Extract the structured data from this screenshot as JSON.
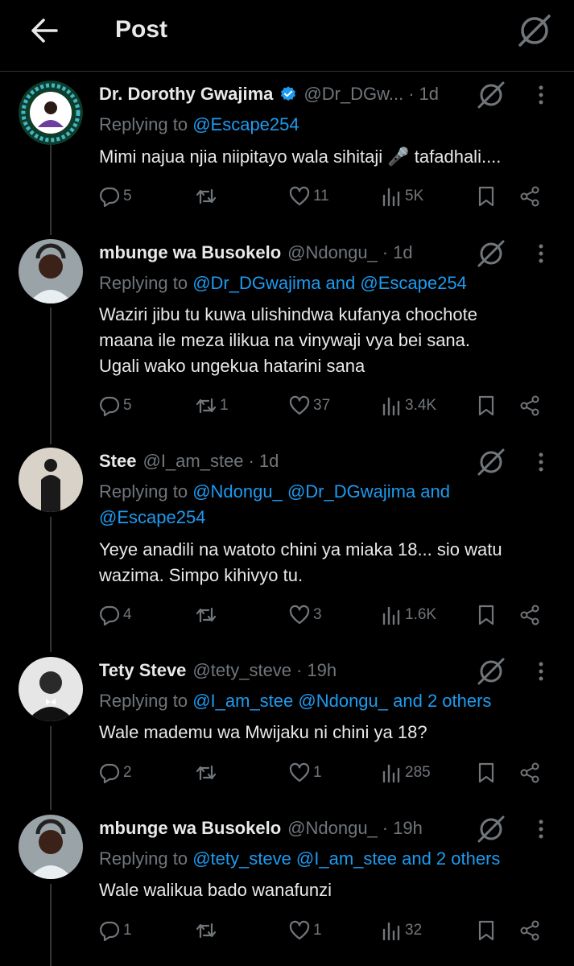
{
  "header": {
    "title": "Post",
    "back_icon": "back-arrow-icon",
    "grok_icon": "grok-icon"
  },
  "colors": {
    "background": "#000000",
    "text": "#e7e9ea",
    "muted": "#71767b",
    "link": "#1d9bf0",
    "verified": "#1d9bf0"
  },
  "posts": [
    {
      "name": "Dr. Dorothy Gwajima",
      "verified": true,
      "handle": "@Dr_DGw...",
      "time": "1d",
      "replying_prefix": "Replying to",
      "replying_to": "@Escape254",
      "text_lines": [
        "Mimi najua njia niipitayo wala sihitaji 🎤 tafadhali...."
      ],
      "replies": "5",
      "reposts": "",
      "likes": "11",
      "views": "5K"
    },
    {
      "name": "mbunge wa Busokelo",
      "verified": false,
      "handle": "@Ndongu_",
      "time": "1d",
      "replying_prefix": "Replying to",
      "replying_to": "@Dr_DGwajima and @Escape254",
      "text_lines": [
        "Waziri jibu tu kuwa ulishindwa kufanya chochote",
        "maana ile meza ilikua na vinywaji vya bei sana.",
        "Ugali wako ungekua hatarini sana"
      ],
      "replies": "5",
      "reposts": "1",
      "likes": "37",
      "views": "3.4K"
    },
    {
      "name": "Stee",
      "verified": false,
      "handle": "@I_am_stee",
      "time": "1d",
      "replying_prefix": "Replying to",
      "replying_to": "@Ndongu_ @Dr_DGwajima and",
      "replying_to_2": "@Escape254",
      "text_lines": [
        "Yeye anadili na watoto chini ya miaka 18... sio watu",
        "wazima. Simpo kihivyo tu."
      ],
      "replies": "4",
      "reposts": "",
      "likes": "3",
      "views": "1.6K"
    },
    {
      "name": "Tety Steve",
      "verified": false,
      "handle": "@tety_steve",
      "time": "19h",
      "replying_prefix": "Replying to",
      "replying_to": "@I_am_stee @Ndongu_ and 2 others",
      "text_lines": [
        "Wale mademu wa Mwijaku ni chini ya 18?"
      ],
      "replies": "2",
      "reposts": "",
      "likes": "1",
      "views": "285"
    },
    {
      "name": "mbunge wa Busokelo",
      "verified": false,
      "handle": "@Ndongu_",
      "time": "19h",
      "replying_prefix": "Replying to",
      "replying_to": "@tety_steve @I_am_stee and 2 others",
      "text_lines": [
        "Wale walikua bado wanafunzi"
      ],
      "replies": "1",
      "reposts": "",
      "likes": "1",
      "views": "32"
    }
  ]
}
